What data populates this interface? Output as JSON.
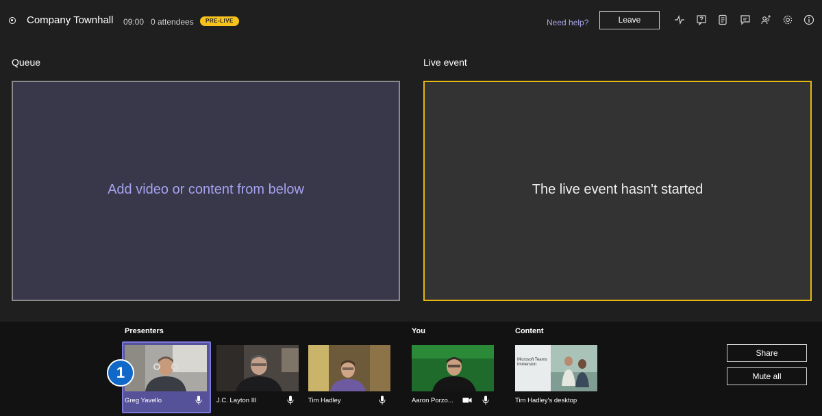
{
  "header": {
    "title": "Company Townhall",
    "time": "09:00",
    "attendees": "0 attendees",
    "status_badge": "PRE-LIVE",
    "help_link": "Need help?",
    "leave_label": "Leave",
    "icons": [
      "health-icon",
      "qna-icon",
      "notes-icon",
      "chat-icon",
      "people-icon",
      "settings-icon",
      "info-icon"
    ]
  },
  "queue": {
    "label": "Queue",
    "placeholder": "Add video or content from below"
  },
  "live": {
    "label": "Live event",
    "status": "The live event hasn't started"
  },
  "bottom": {
    "presenters_label": "Presenters",
    "you_label": "You",
    "content_label": "Content",
    "presenters": [
      {
        "name": "Greg Yavello",
        "selected": true
      },
      {
        "name": "J.C. Layton III",
        "selected": false
      },
      {
        "name": "Tim Hadley",
        "selected": false
      }
    ],
    "you": {
      "name": "Aaron Porzo..."
    },
    "content": {
      "name": "Tim Hadley's desktop",
      "slide_text": "Microsoft Teams Immersion"
    },
    "callout_number": "1",
    "share_label": "Share",
    "mute_all_label": "Mute all"
  },
  "colors": {
    "accent": "#7c79d8",
    "live_border": "#e7b80f",
    "badge": "#f8c21c",
    "callout": "#1069c8"
  }
}
